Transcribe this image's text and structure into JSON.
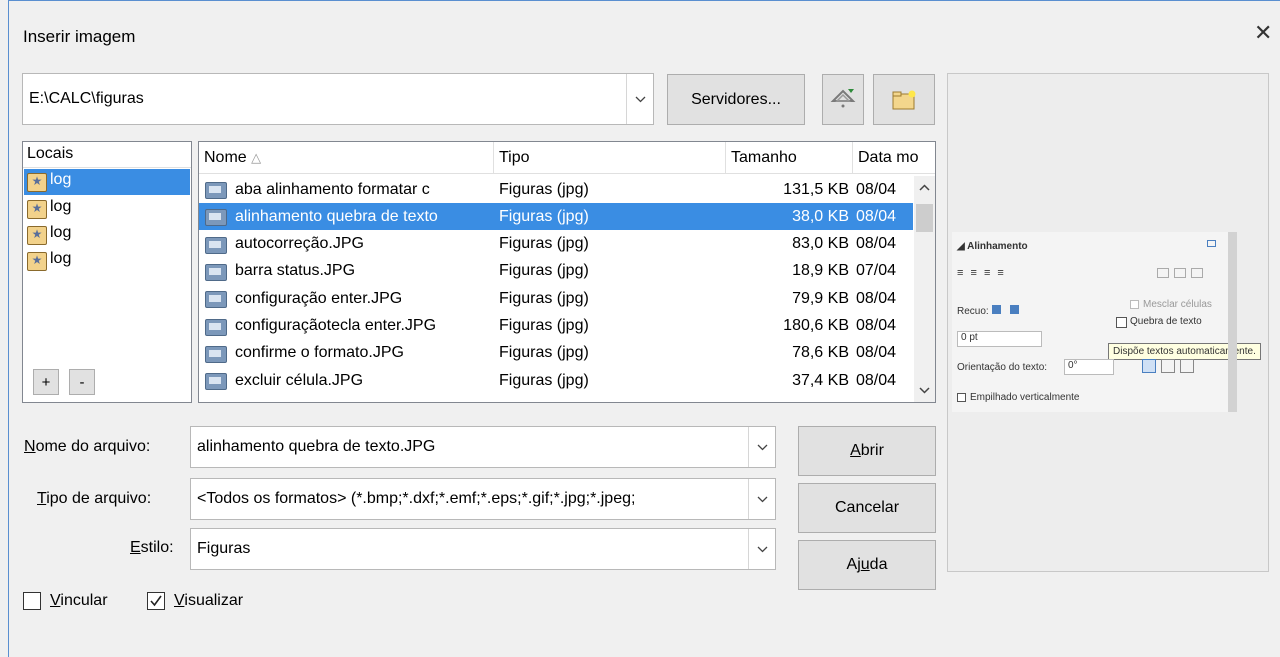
{
  "dialog": {
    "title": "Inserir imagem",
    "close_glyph": "✕"
  },
  "toolbar": {
    "path_value": "E:\\CALC\\figuras",
    "servers_button": "Servidores...",
    "up_icon": "folder-up-icon",
    "new_folder_icon": "new-folder-icon"
  },
  "places": {
    "header": "Locais",
    "items": [
      {
        "label": "log"
      },
      {
        "label": "log"
      },
      {
        "label": "log"
      },
      {
        "label": "log"
      }
    ],
    "add_button": "+",
    "remove_button": "-"
  },
  "files": {
    "columns": {
      "name": "Nome",
      "type": "Tipo",
      "size": "Tamanho",
      "date": "Data mo"
    },
    "sort_indicator": "△",
    "rows": [
      {
        "name": "aba alinhamento formatar c",
        "type": "Figuras (jpg)",
        "size": "131,5 KB",
        "date": "08/04"
      },
      {
        "name": "alinhamento quebra de texto",
        "type": "Figuras (jpg)",
        "size": "38,0 KB",
        "date": "08/04"
      },
      {
        "name": "autocorreção.JPG",
        "type": "Figuras (jpg)",
        "size": "83,0 KB",
        "date": "08/04"
      },
      {
        "name": "barra status.JPG",
        "type": "Figuras (jpg)",
        "size": "18,9 KB",
        "date": "07/04"
      },
      {
        "name": "configuração enter.JPG",
        "type": "Figuras (jpg)",
        "size": "79,9 KB",
        "date": "08/04"
      },
      {
        "name": "configuraçãotecla enter.JPG",
        "type": "Figuras (jpg)",
        "size": "180,6 KB",
        "date": "08/04"
      },
      {
        "name": "confirme o formato.JPG",
        "type": "Figuras (jpg)",
        "size": "78,6 KB",
        "date": "08/04"
      },
      {
        "name": "excluir célula.JPG",
        "type": "Figuras (jpg)",
        "size": "37,4 KB",
        "date": "08/04"
      }
    ]
  },
  "form": {
    "filename_label": "Nome do arquivo:",
    "filename_label_u": "N",
    "filename_label_rest": "ome do arquivo:",
    "filename_value": "alinhamento quebra de texto.JPG",
    "filetype_label_u": "T",
    "filetype_label_rest": "ipo de arquivo:",
    "filetype_value": "<Todos os formatos> (*.bmp;*.dxf;*.emf;*.eps;*.gif;*.jpg;*.jpeg;",
    "style_label_u": "E",
    "style_label_rest": "stilo:",
    "style_value": "Figuras"
  },
  "buttons": {
    "open_u": "A",
    "open_rest": "brir",
    "cancel": "Cancelar",
    "help_pre": "Aj",
    "help_u": "u",
    "help_post": "da"
  },
  "options": {
    "link_u": "V",
    "link_rest": "incular",
    "link_checked": false,
    "preview_u": "V",
    "preview_rest": "isualizar",
    "preview_checked": true
  },
  "preview": {
    "section": "Alinhamento",
    "indent_label": "Recuo:",
    "indent_value": "0 pt",
    "merge_cells": "Mesclar células",
    "wrap_text": "Quebra de texto",
    "tooltip": "Dispõe textos automaticamente.",
    "orientation_label": "Orientação do texto:",
    "orientation_value": "0°",
    "stacked": "Empilhado verticalmente"
  }
}
